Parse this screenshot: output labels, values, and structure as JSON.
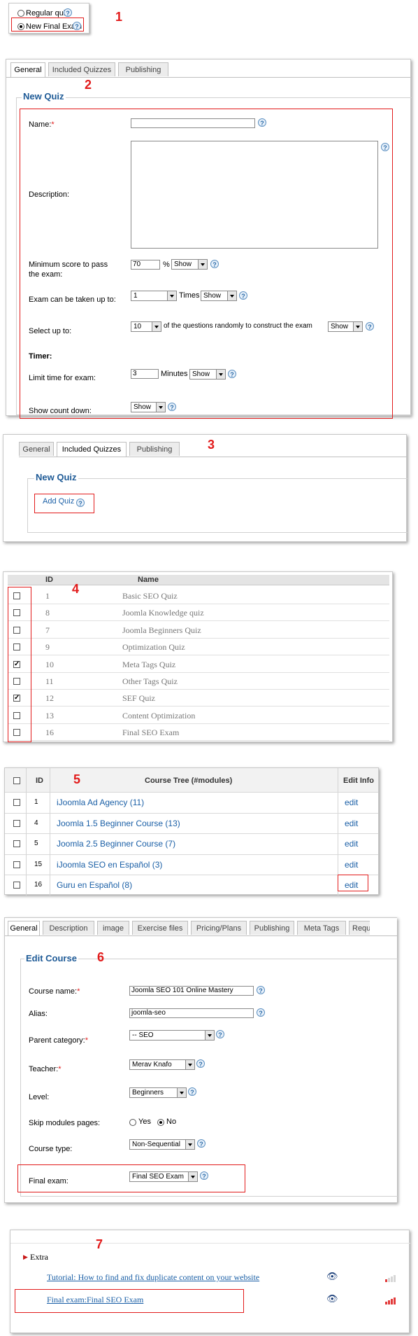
{
  "section1": {
    "number": "1",
    "options": [
      "Regular quiz",
      "New Final Exam"
    ],
    "selected_index": 1
  },
  "section2": {
    "number": "2",
    "tabs": [
      "General",
      "Included Quizzes",
      "Publishing"
    ],
    "legend": "New Quiz",
    "fields": {
      "name": "Name:",
      "description": "Description:",
      "min_score": "Minimum score to pass the exam:",
      "min_score_value": "70",
      "percent": "%",
      "show": "Show",
      "exam_taken": "Exam can be taken up to:",
      "exam_taken_value": "1",
      "times": "Times",
      "select_up_to": "Select up to:",
      "select_up_to_value": "10",
      "select_up_to_suffix": "of the questions randomly to construct the exam",
      "timer": "Timer:",
      "limit_time": "Limit time for exam:",
      "limit_time_value": "3",
      "minutes": "Minutes",
      "show_count_down": "Show count down:"
    }
  },
  "section3": {
    "number": "3",
    "tabs": [
      "General",
      "Included Quizzes",
      "Publishing"
    ],
    "legend": "New Quiz",
    "add_quiz": "Add Quiz"
  },
  "section4": {
    "number": "4",
    "columns": [
      "ID",
      "Name"
    ],
    "rows": [
      {
        "id": "1",
        "name": "Basic SEO Quiz",
        "checked": false
      },
      {
        "id": "8",
        "name": "Joomla Knowledge quiz",
        "checked": false
      },
      {
        "id": "7",
        "name": "Joomla Beginners Quiz",
        "checked": false
      },
      {
        "id": "9",
        "name": "Optimization Quiz",
        "checked": false
      },
      {
        "id": "10",
        "name": "Meta Tags Quiz",
        "checked": true
      },
      {
        "id": "11",
        "name": "Other Tags Quiz",
        "checked": false
      },
      {
        "id": "12",
        "name": "SEF Quiz",
        "checked": true
      },
      {
        "id": "13",
        "name": "Content Optimization",
        "checked": false
      },
      {
        "id": "16",
        "name": "Final SEO Exam",
        "checked": false
      }
    ]
  },
  "section5": {
    "number": "5",
    "columns": [
      "ID",
      "Course Tree (#modules)",
      "Edit Info"
    ],
    "rows": [
      {
        "id": "1",
        "name": "iJoomla Ad Agency (11)",
        "edit": "edit"
      },
      {
        "id": "4",
        "name": "Joomla 1.5 Beginner Course (13)",
        "edit": "edit"
      },
      {
        "id": "5",
        "name": "Joomla 2.5 Beginner Course (7)",
        "edit": "edit"
      },
      {
        "id": "15",
        "name": "iJoomla SEO en Español (3)",
        "edit": "edit"
      },
      {
        "id": "16",
        "name": "Guru en Español (8)",
        "edit": "edit"
      }
    ]
  },
  "section6": {
    "number": "6",
    "tabs": [
      "General",
      "Description",
      "image",
      "Exercise files",
      "Pricing/Plans",
      "Publishing",
      "Meta Tags",
      "Requi"
    ],
    "legend": "Edit Course",
    "fields": {
      "course_name": "Course name:",
      "course_name_value": "Joomla SEO 101 Online Mastery",
      "alias": "Alias:",
      "alias_value": "joomla-seo",
      "parent_category": "Parent category:",
      "parent_category_value": "-- SEO",
      "teacher": "Teacher:",
      "teacher_value": "Merav Knafo",
      "level": "Level:",
      "level_value": "Beginners",
      "skip_modules": "Skip modules pages:",
      "yes": "Yes",
      "no": "No",
      "course_type": "Course type:",
      "course_type_value": "Non-Sequential",
      "final_exam": "Final exam:",
      "final_exam_value": "Final SEO Exam"
    }
  },
  "section7": {
    "number": "7",
    "heading": "Extra",
    "items": [
      "Tutorial: How to find and fix duplicate content on your website",
      "Final exam:Final SEO Exam"
    ]
  }
}
